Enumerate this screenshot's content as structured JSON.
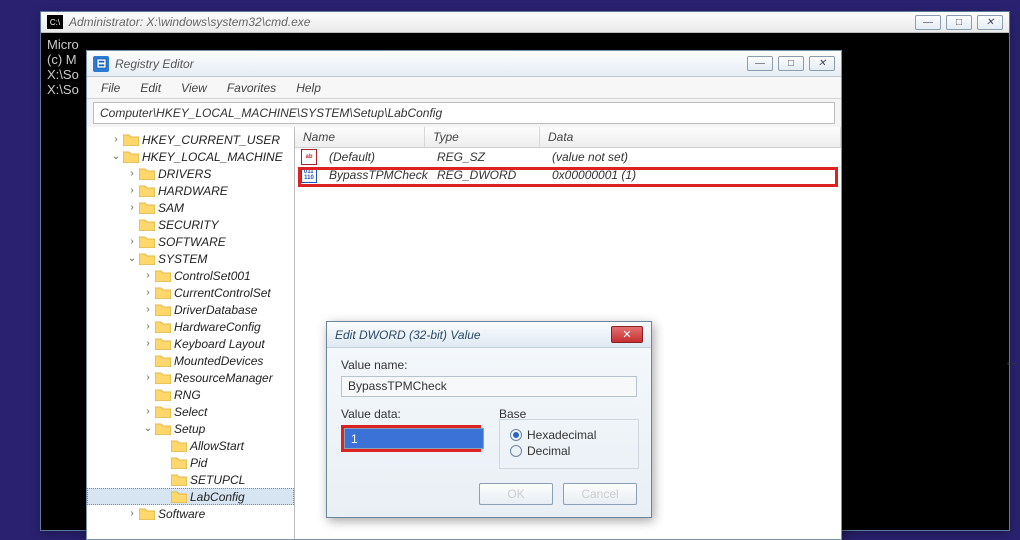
{
  "cmd": {
    "title": "Administrator: X:\\windows\\system32\\cmd.exe",
    "icon_label": "C:\\",
    "lines": [
      "Micro",
      "(c) M",
      "",
      "X:\\So",
      "",
      "X:\\So"
    ]
  },
  "regedit": {
    "title": "Registry Editor",
    "menu": [
      "File",
      "Edit",
      "View",
      "Favorites",
      "Help"
    ],
    "path": "Computer\\HKEY_LOCAL_MACHINE\\SYSTEM\\Setup\\LabConfig",
    "tree": [
      {
        "depth": 1,
        "twist": ">",
        "label": "HKEY_CURRENT_USER"
      },
      {
        "depth": 1,
        "twist": "v",
        "label": "HKEY_LOCAL_MACHINE"
      },
      {
        "depth": 2,
        "twist": ">",
        "label": "DRIVERS"
      },
      {
        "depth": 2,
        "twist": ">",
        "label": "HARDWARE"
      },
      {
        "depth": 2,
        "twist": ">",
        "label": "SAM"
      },
      {
        "depth": 2,
        "twist": "",
        "label": "SECURITY"
      },
      {
        "depth": 2,
        "twist": ">",
        "label": "SOFTWARE"
      },
      {
        "depth": 2,
        "twist": "v",
        "label": "SYSTEM"
      },
      {
        "depth": 3,
        "twist": ">",
        "label": "ControlSet001"
      },
      {
        "depth": 3,
        "twist": ">",
        "label": "CurrentControlSet"
      },
      {
        "depth": 3,
        "twist": ">",
        "label": "DriverDatabase"
      },
      {
        "depth": 3,
        "twist": ">",
        "label": "HardwareConfig"
      },
      {
        "depth": 3,
        "twist": ">",
        "label": "Keyboard Layout"
      },
      {
        "depth": 3,
        "twist": "",
        "label": "MountedDevices"
      },
      {
        "depth": 3,
        "twist": ">",
        "label": "ResourceManager"
      },
      {
        "depth": 3,
        "twist": "",
        "label": "RNG"
      },
      {
        "depth": 3,
        "twist": ">",
        "label": "Select"
      },
      {
        "depth": 3,
        "twist": "v",
        "label": "Setup"
      },
      {
        "depth": 4,
        "twist": "",
        "label": "AllowStart"
      },
      {
        "depth": 4,
        "twist": "",
        "label": "Pid"
      },
      {
        "depth": 4,
        "twist": "",
        "label": "SETUPCL"
      },
      {
        "depth": 4,
        "twist": "",
        "label": "LabConfig",
        "selected": true
      },
      {
        "depth": 2,
        "twist": ">",
        "label": "Software"
      }
    ],
    "columns": {
      "name": "Name",
      "type": "Type",
      "data": "Data"
    },
    "rows": [
      {
        "icon": "str",
        "name": "(Default)",
        "type": "REG_SZ",
        "data": "(value not set)"
      },
      {
        "icon": "bin",
        "name": "BypassTPMCheck",
        "type": "REG_DWORD",
        "data": "0x00000001 (1)",
        "highlight": true
      }
    ]
  },
  "dialog": {
    "title": "Edit DWORD (32-bit) Value",
    "name_label": "Value name:",
    "name_value": "BypassTPMCheck",
    "data_label": "Value data:",
    "data_value": "1",
    "base_label": "Base",
    "radio_hex": "Hexadecimal",
    "radio_dec": "Decimal",
    "ok": "OK",
    "cancel": "Cancel"
  },
  "winbtns": {
    "min": "—",
    "max": "□",
    "close": "✕"
  }
}
